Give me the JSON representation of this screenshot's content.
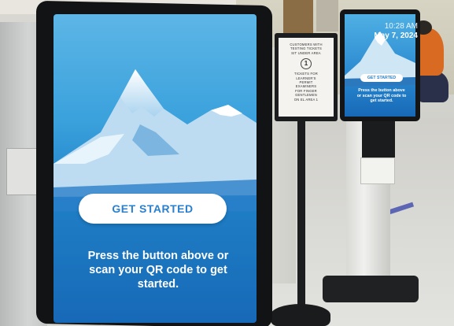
{
  "main_kiosk": {
    "time": "10:28 AM",
    "date": "May 7, 2024",
    "button_label": "GET STARTED",
    "instructions": "Press the button above or scan your QR code to get started."
  },
  "sign": {
    "lines": [
      "CUSTOMERS WITH",
      "TESTING TICKETS",
      "SIT UNDER AREA"
    ],
    "number": "1",
    "lines_after": [
      "TICKETS FOR",
      "LEARNER'S",
      "PERMIT",
      "EXAMINERS",
      "FOR FINGER",
      "GENTLEMEN",
      "ON EL AREA 1"
    ]
  },
  "second_kiosk": {
    "button_label": "GET STARTED",
    "instructions": "Press the button above or scan your QR code to get started."
  },
  "colors": {
    "screen_top": "#5db6e6",
    "screen_bottom": "#1769b7",
    "button_text": "#2a7fce",
    "frame": "#121314"
  }
}
